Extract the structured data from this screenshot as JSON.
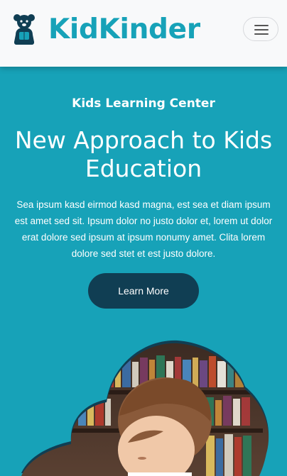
{
  "navbar": {
    "brand": "KidKinder",
    "logo_icon": "teddy-bear-icon",
    "menu_icon": "hamburger-menu-icon"
  },
  "hero": {
    "subtitle": "Kids Learning Center",
    "title": "New Approach to Kids Education",
    "description": "Sea ipsum kasd eirmod kasd magna, est sea et diam ipsum est amet sed sit. Ipsum dolor no justo dolor et, lorem ut dolor erat dolore sed ipsum at ipsum nonumy amet. Clita lorem dolore sed stet et est justo dolore.",
    "button_label": "Learn More",
    "image": "child-reading-photo"
  },
  "colors": {
    "primary": "#17a2b8",
    "navbar_bg": "#f8f9fa",
    "button_bg": "#103e53",
    "text_light": "#ffffff"
  }
}
